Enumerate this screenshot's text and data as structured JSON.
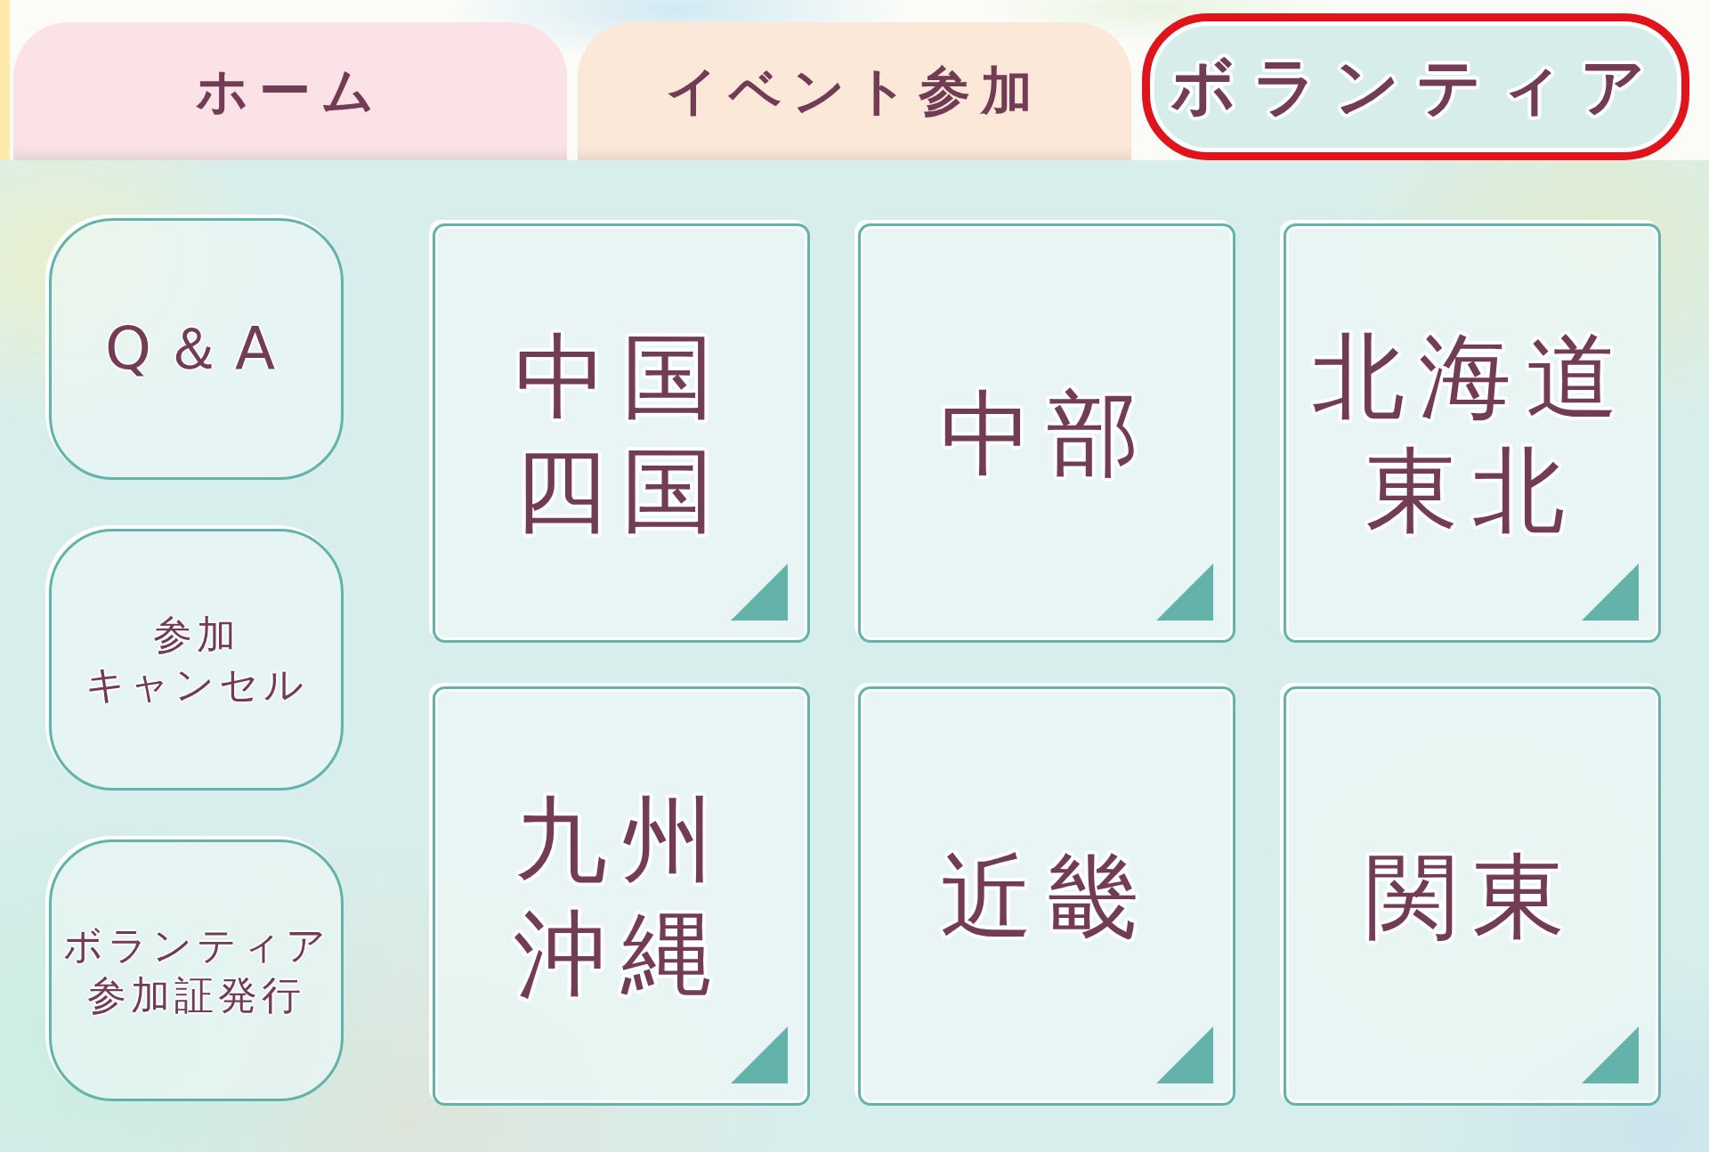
{
  "tabs": [
    {
      "label": "ホーム",
      "selected": false,
      "color": "#fbe2e6"
    },
    {
      "label": "イベント参加",
      "selected": false,
      "color": "#fce8d9"
    },
    {
      "label": "ボランティア",
      "selected": true,
      "color": "#d6edea"
    }
  ],
  "menu_buttons": [
    {
      "lines": [
        "Q＆A"
      ]
    },
    {
      "lines": [
        "参加",
        "キャンセル"
      ]
    },
    {
      "lines": [
        "ボランティア",
        "参加証発行"
      ]
    }
  ],
  "regions": [
    {
      "lines": [
        "中国",
        "四国"
      ]
    },
    {
      "lines": [
        "中部"
      ]
    },
    {
      "lines": [
        "北海道",
        "東北"
      ]
    },
    {
      "lines": [
        "九州",
        "沖縄"
      ]
    },
    {
      "lines": [
        "近畿"
      ]
    },
    {
      "lines": [
        "関東"
      ]
    }
  ]
}
